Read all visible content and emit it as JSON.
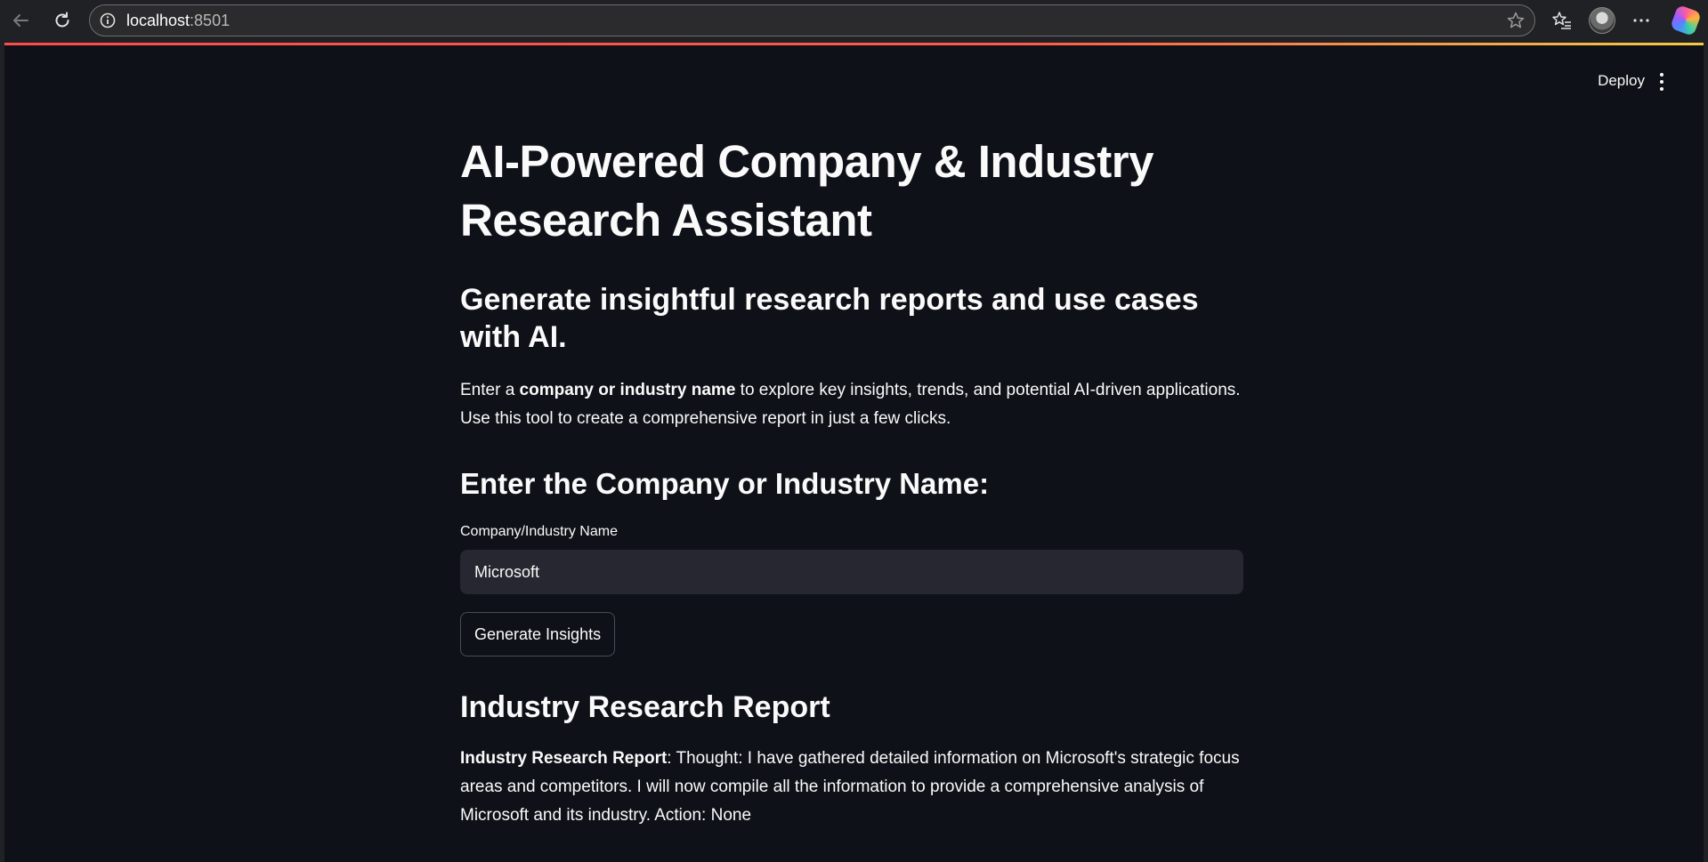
{
  "browser": {
    "url_host": "localhost",
    "url_port": ":8501"
  },
  "app": {
    "deploy_label": "Deploy",
    "title": "AI-Powered Company & Industry Research Assistant",
    "subtitle": "Generate insightful research reports and use cases with AI.",
    "intro": {
      "prefix": "Enter a ",
      "bold": "company or industry name",
      "suffix": " to explore key insights, trends, and potential AI-driven applications. Use this tool to create a comprehensive report in just a few clicks."
    },
    "input_heading": "Enter the Company or Industry Name:",
    "input_label": "Company/Industry Name",
    "input_value": "Microsoft",
    "generate_button": "Generate Insights",
    "report_heading": "Industry Research Report",
    "report": {
      "bold": "Industry Research Report",
      "text": ": Thought: I have gathered detailed information on Microsoft's strategic focus areas and competitors. I will now compile all the information to provide a comprehensive analysis of Microsoft and its industry. Action: None"
    }
  },
  "colors": {
    "app_background": "#0e1117",
    "input_background": "#262730",
    "stripe_start": "#ff4b4b",
    "stripe_end": "#f5c945"
  }
}
